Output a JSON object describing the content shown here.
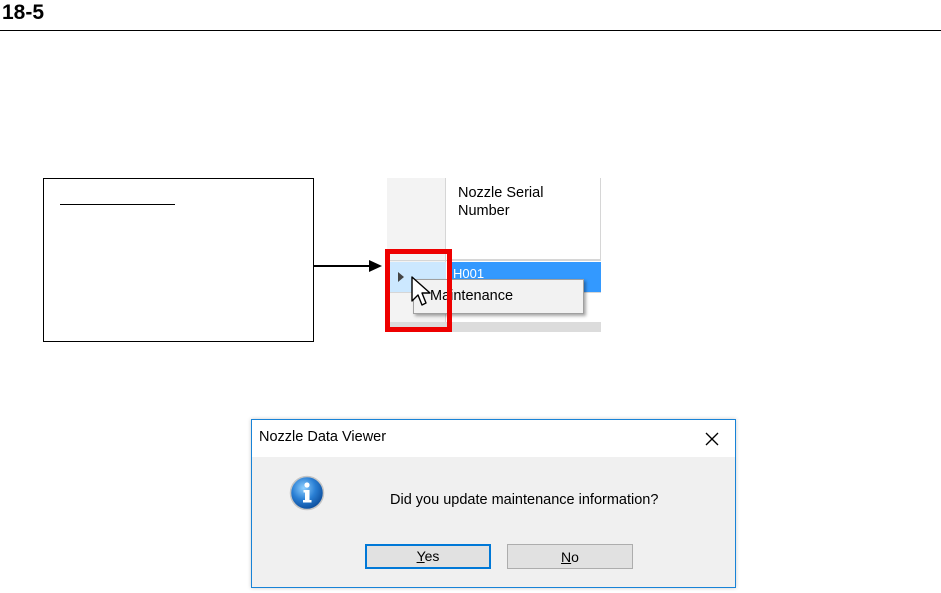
{
  "page": {
    "section_number": "18-5"
  },
  "grid": {
    "column_header": "Nozzle Serial Number",
    "selected_cell_value": "H001"
  },
  "context_menu": {
    "items": [
      {
        "label": "Maintenance"
      }
    ]
  },
  "dialog": {
    "title": "Nozzle Data Viewer",
    "close_glyph": "✕",
    "message": "Did you update maintenance information?",
    "icon": "info-icon",
    "buttons": {
      "yes": {
        "mnemonic": "Y",
        "rest": "es"
      },
      "no": {
        "mnemonic": "N",
        "rest": "o"
      }
    }
  },
  "colors": {
    "selection_blue": "#3399ff",
    "highlight_red": "#ee0000",
    "dialog_border": "#1883d7",
    "default_button_border": "#0078d7"
  }
}
